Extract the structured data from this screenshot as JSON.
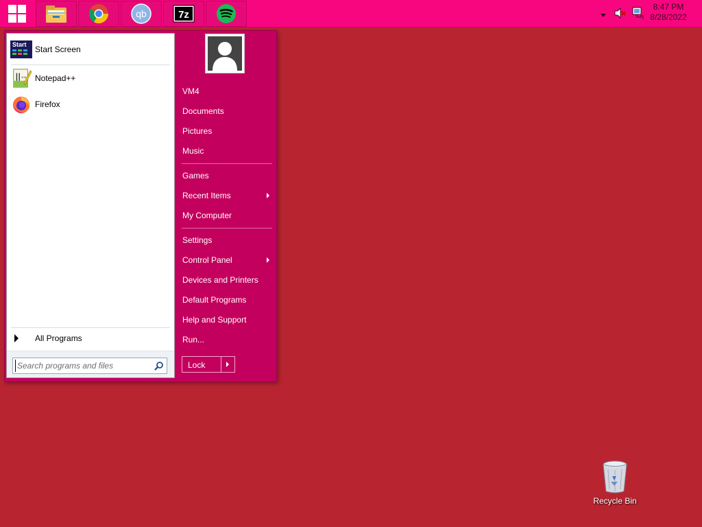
{
  "taskbar": {
    "start_button": {
      "icon": "windows-logo-icon"
    },
    "pinned": [
      {
        "name": "File Explorer",
        "icon": "file-explorer-icon"
      },
      {
        "name": "Google Chrome",
        "icon": "chrome-icon"
      },
      {
        "name": "qBittorrent",
        "icon": "qbittorrent-icon",
        "text": "qb"
      },
      {
        "name": "7-Zip",
        "icon": "7zip-icon",
        "text": "7z"
      },
      {
        "name": "Spotify",
        "icon": "spotify-icon"
      }
    ],
    "tray": {
      "show_hidden_icon": "chevron-down-icon",
      "volume_icon": "volume-muted-icon",
      "network_icon": "network-icon"
    },
    "clock": {
      "time": "8:47 PM",
      "date": "8/28/2022"
    },
    "colors": {
      "background": "#f8067f"
    }
  },
  "start_menu": {
    "colors": {
      "right_pane": "#c4005e"
    },
    "programs": [
      {
        "label": "Start Screen",
        "icon": "start-screen-icon",
        "icon_text": "Start"
      },
      {
        "label": "Notepad++",
        "icon": "notepadpp-icon"
      },
      {
        "label": "Firefox",
        "icon": "firefox-icon"
      }
    ],
    "all_programs": "All Programs",
    "search": {
      "placeholder": "Search programs and files",
      "value": ""
    },
    "user": {
      "avatar_icon": "user-avatar-icon"
    },
    "places": [
      {
        "label": "VM4",
        "has_submenu": false
      },
      {
        "label": "Documents",
        "has_submenu": false
      },
      {
        "label": "Pictures",
        "has_submenu": false
      },
      {
        "label": "Music",
        "has_submenu": false
      },
      {
        "label": "Games",
        "has_submenu": false
      },
      {
        "label": "Recent Items",
        "has_submenu": true
      },
      {
        "label": "My Computer",
        "has_submenu": false
      },
      {
        "label": "Settings",
        "has_submenu": false
      },
      {
        "label": "Control Panel",
        "has_submenu": true
      },
      {
        "label": "Devices and Printers",
        "has_submenu": false
      },
      {
        "label": "Default Programs",
        "has_submenu": false
      },
      {
        "label": "Help and Support",
        "has_submenu": false
      },
      {
        "label": "Run...",
        "has_submenu": false
      }
    ],
    "power": {
      "label": "Lock"
    }
  },
  "desktop": {
    "background_color": "#b82531",
    "icons": [
      {
        "label": "Recycle Bin",
        "icon": "recycle-bin-icon"
      }
    ]
  }
}
